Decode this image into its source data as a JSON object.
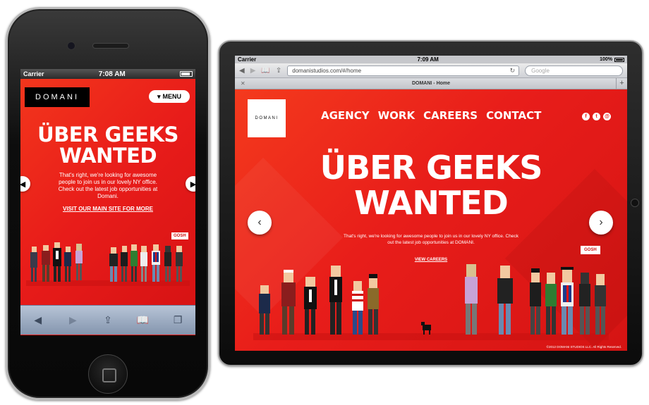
{
  "phone": {
    "status": {
      "carrier": "Carrier",
      "time": "7:08 AM"
    },
    "logo": "DOMANI",
    "menu": {
      "icon": "triangle-down-icon",
      "label": "MENU"
    },
    "headline_line1": "ÜBER GEEKS",
    "headline_line2": "WANTED",
    "paragraph": "That's right, we're looking for awesome people to join us in our lovely NY office. Check out the latest job opportunities at Domani.",
    "link": "VISIT OUR MAIN SITE FOR MORE",
    "bubble": "GOSH",
    "toolbar": {
      "back_icon": "back-arrow-icon",
      "forward_icon": "forward-arrow-icon",
      "share_icon": "share-icon",
      "bookmarks_icon": "bookmarks-icon",
      "tabs_icon": "tabs-icon"
    }
  },
  "tablet": {
    "status": {
      "carrier": "Carrier",
      "time": "7:09 AM",
      "battery": "100%"
    },
    "url": "domanistudios.com/#/home",
    "search_placeholder": "Google",
    "tab_title": "DOMANI - Home",
    "logo": "DOMANI",
    "menu": [
      "AGENCY",
      "WORK",
      "CAREERS",
      "CONTACT"
    ],
    "social_icons": [
      "facebook-icon",
      "twitter-icon",
      "email-icon"
    ],
    "headline_line1": "ÜBER GEEKS",
    "headline_line2": "WANTED",
    "paragraph": "That's right, we're looking for awesome people to join us in our lovely NY office. Check out the latest job opportunities at DOMANI.",
    "link": "VIEW CAREERS",
    "bubble": "GOSH",
    "copyright": "©2012 DOMANI STUDIOS LLC. All Rights Reserved."
  },
  "colors": {
    "brand_red": "#e8201c",
    "black": "#000000",
    "white": "#ffffff"
  }
}
